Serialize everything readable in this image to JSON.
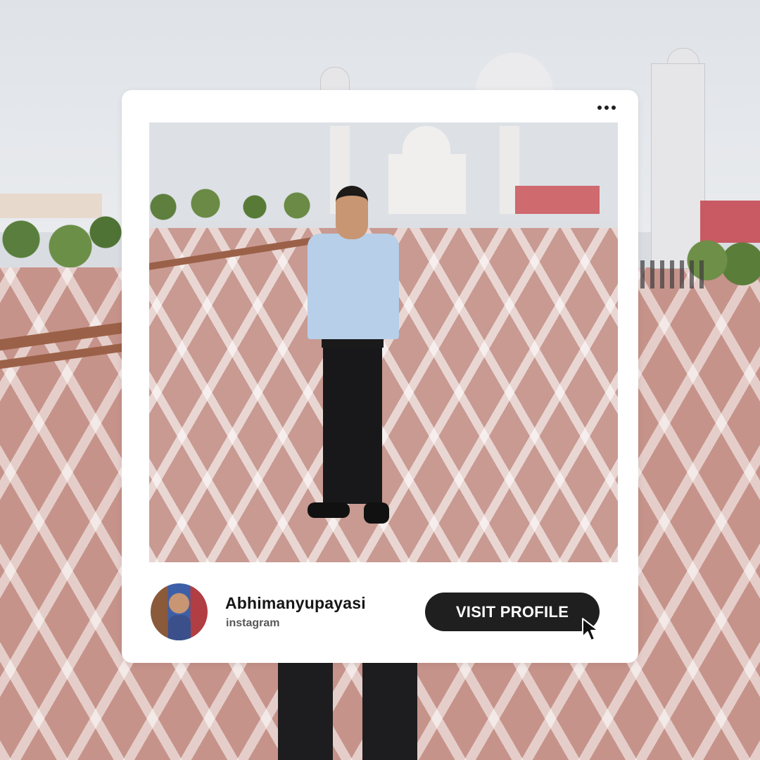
{
  "post": {
    "menu_icon": "more-horizontal-icon",
    "username": "Abhimanyupayasi",
    "platform": "instagram",
    "visit_label": "VISIT PROFILE",
    "cursor_icon": "mouse-pointer-icon"
  },
  "colors": {
    "card": "#ffffff",
    "button": "#1f1f1f",
    "button_text": "#ffffff",
    "username": "#161616",
    "platform": "#575757"
  }
}
